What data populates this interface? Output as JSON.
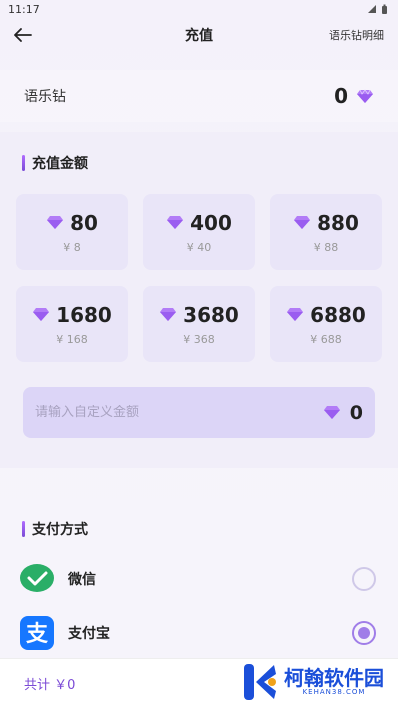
{
  "status_bar": {
    "time": "11:17"
  },
  "header": {
    "title": "充值",
    "detail_link": "语乐钻明细",
    "back_icon": "arrow-left-icon"
  },
  "balance": {
    "label": "语乐钻",
    "value": "0"
  },
  "recharge": {
    "section_title": "充值金额",
    "options": [
      {
        "amount": "80",
        "price": "¥ 8"
      },
      {
        "amount": "400",
        "price": "¥ 40"
      },
      {
        "amount": "880",
        "price": "¥ 88"
      },
      {
        "amount": "1680",
        "price": "¥ 168"
      },
      {
        "amount": "3680",
        "price": "¥ 368"
      },
      {
        "amount": "6880",
        "price": "¥ 688"
      }
    ],
    "custom_placeholder": "请输入自定义金额",
    "custom_value": "0"
  },
  "payment": {
    "section_title": "支付方式",
    "methods": [
      {
        "label": "微信",
        "icon": "wechat-icon",
        "selected": false
      },
      {
        "label": "支付宝",
        "icon": "alipay-icon",
        "selected": true
      }
    ]
  },
  "footer": {
    "total": "共计 ￥0"
  },
  "watermark": {
    "text": "柯翰软件园",
    "sub": "KEHAN38.COM"
  },
  "colors": {
    "accent": "#a07de8",
    "diamond": "#a86df5",
    "wechat": "#2aae67",
    "alipay": "#1677ff"
  }
}
